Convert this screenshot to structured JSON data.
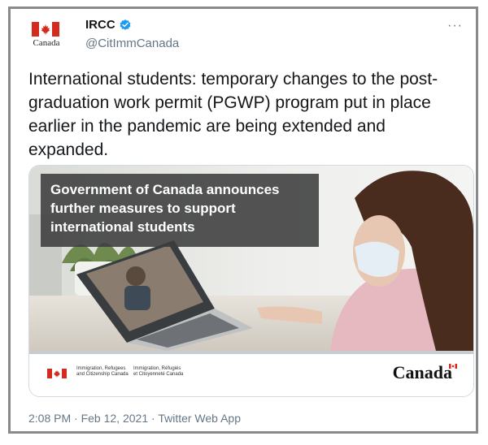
{
  "account": {
    "display_name": "IRCC",
    "handle": "@CitImmCanada",
    "logo_wordmark": "Canada"
  },
  "tweet": {
    "lines": [
      "International students: temporary changes to the post-",
      "graduation work permit (PGWP) program put in place",
      "earlier in the pandemic are being extended and",
      "expanded."
    ]
  },
  "card": {
    "headline_lines": [
      "Government of Canada announces",
      "further measures to support",
      "international students"
    ],
    "dept_en": [
      "Immigration, Refugees",
      "and Citizenship Canada"
    ],
    "dept_fr": [
      "Immigration, Réfugiés",
      "et Citoyenneté Canada"
    ],
    "wordmark": "Canada"
  },
  "meta": {
    "time": "2:08 PM",
    "date": "Feb 12, 2021",
    "source": "Twitter Web App",
    "separator": "·"
  },
  "icons": [
    "canada-flag-icon",
    "verified-badge-icon",
    "more-options-icon"
  ],
  "colors": {
    "canada_red": "#d52b1e",
    "verified_blue": "#1d9bf0",
    "text_primary": "#14171a",
    "text_secondary": "#657786"
  }
}
